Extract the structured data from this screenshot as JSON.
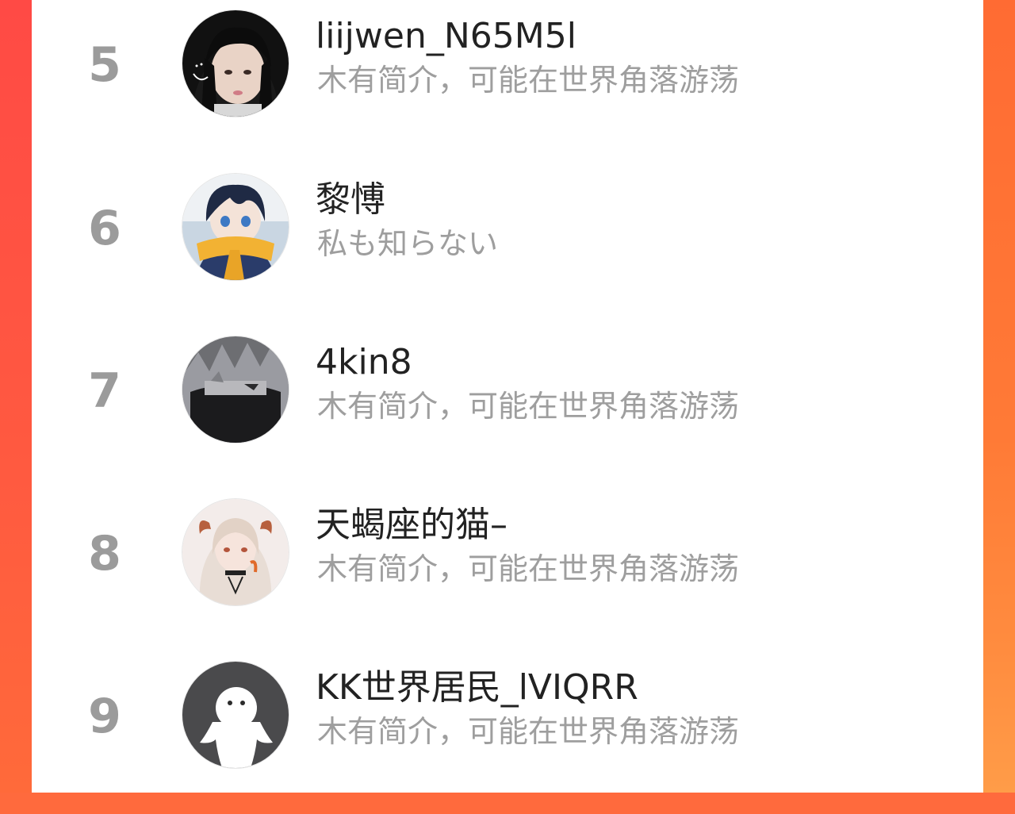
{
  "ranking": {
    "items": [
      {
        "rank": "5",
        "name": "liijwen_N65M5l",
        "bio": "木有简介，可能在世界角落游荡",
        "avatar": "girl-black-hair-photo-icon"
      },
      {
        "rank": "6",
        "name": "黎愽",
        "bio": "私も知らない",
        "avatar": "anime-boy-yellow-scarf-icon"
      },
      {
        "rank": "7",
        "name": "4kin8",
        "bio": "木有简介，可能在世界角落游荡",
        "avatar": "masked-ninja-icon"
      },
      {
        "rank": "8",
        "name": "天蝎座的猫–",
        "bio": "木有简介，可能在世界角落游荡",
        "avatar": "anime-girl-horns-icon"
      },
      {
        "rank": "9",
        "name": "KK世界居民_lVIQRR",
        "bio": "木有简介，可能在世界角落游荡",
        "avatar": "default-ghost-avatar-icon"
      }
    ]
  },
  "colors": {
    "rank": "#9b9b9b",
    "name": "#222222",
    "bio": "#9e9e9e",
    "side_left": "#ff4a45",
    "side_right": "#ff7a36"
  }
}
